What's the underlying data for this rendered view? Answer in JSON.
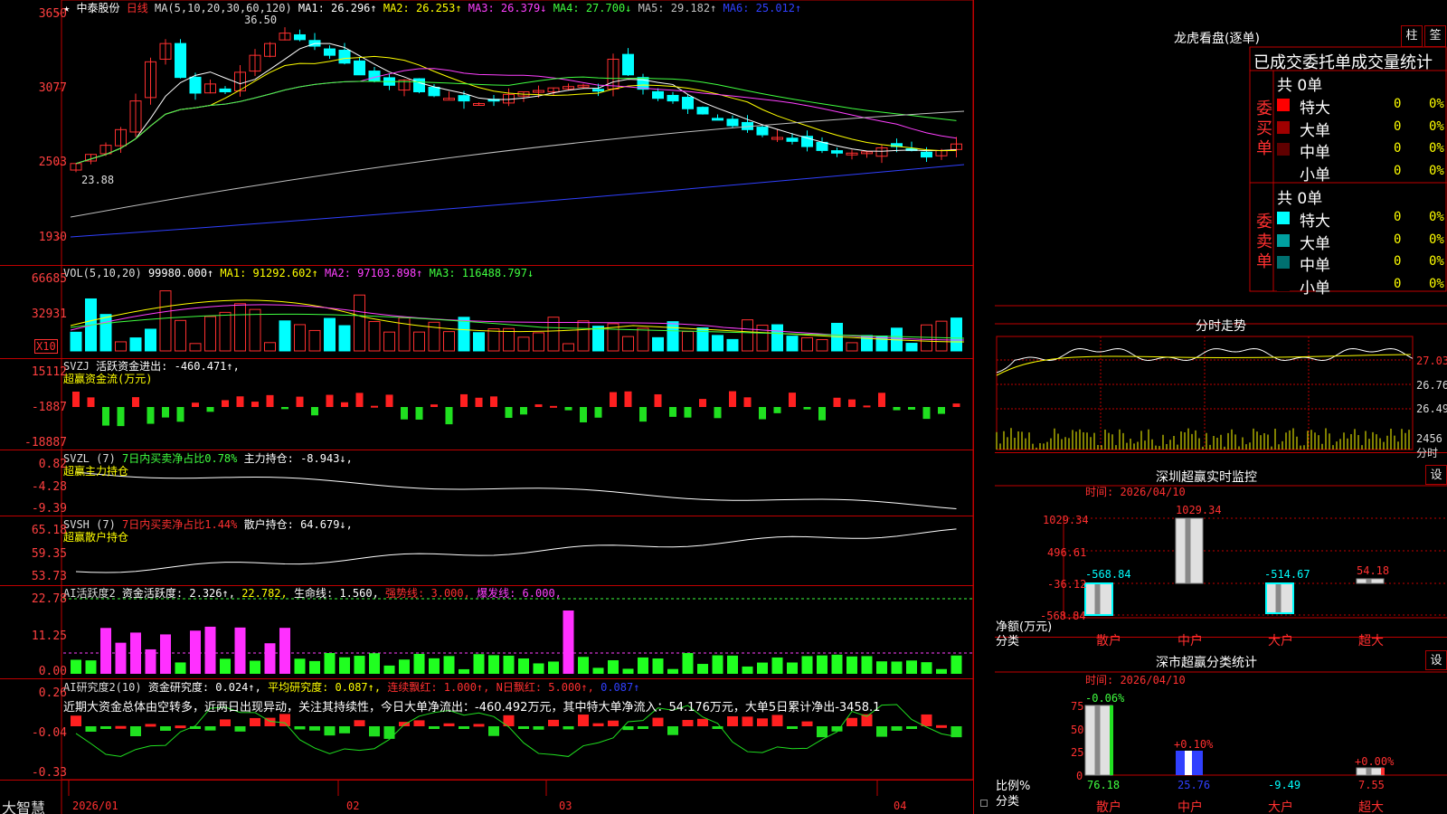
{
  "stock": {
    "star": "★",
    "name": "中泰股份",
    "period": "日线",
    "ma_label": "MA(5,10,20,30,60,120)",
    "ma": [
      {
        "t": "MA1:",
        "v": "26.296↑",
        "c": "#fff"
      },
      {
        "t": "MA2:",
        "v": "26.253↑",
        "c": "#ffff00"
      },
      {
        "t": "MA3:",
        "v": "26.379↓",
        "c": "#ff40ff"
      },
      {
        "t": "MA4:",
        "v": "27.700↓",
        "c": "#40ff40"
      },
      {
        "t": "MA5:",
        "v": "29.182↑",
        "c": "#c0c0c0"
      },
      {
        "t": "MA6:",
        "v": "25.012↑",
        "c": "#3040ff"
      }
    ],
    "high": "36.50",
    "low": "23.88",
    "yticks": [
      "3650",
      "3077",
      "2503",
      "1930"
    ]
  },
  "vol": {
    "label": "VOL(5,10,20)",
    "value": "99980.000↑",
    "ma1": "MA1: 91292.602↑",
    "ma2": "MA2: 97103.898↑",
    "ma3": "MA3: 116488.797↓",
    "yticks": [
      "66685",
      "32931"
    ],
    "unit": "X10"
  },
  "svzj": {
    "label": "SVZJ",
    "title": "活跃资金进出: -460.471↑,",
    "sub": "超赢资金流(万元)",
    "yticks": [
      "15112",
      "-1887",
      "-18887"
    ]
  },
  "svzl": {
    "label": "SVZL (7)",
    "t1": "7日内买卖净占比0.78%",
    "t2": "主力持仓: -8.943↓,",
    "sub": "超赢主力持仓",
    "yticks": [
      "0.82",
      "-4.28",
      "-9.39"
    ]
  },
  "svsh": {
    "label": "SVSH (7)",
    "t1": "7日内买卖净占比1.44%",
    "t2": "散户持仓: 64.679↓,",
    "sub": "超赢散户持仓",
    "yticks": [
      "65.18",
      "59.35",
      "53.73"
    ]
  },
  "ai1": {
    "label": "AI活跃度2",
    "t1": "资金活跃度: 2.326↑,",
    "t2": "22.782,",
    "t3": "生命线: 1.560,",
    "t4": "强势线: 3.000,",
    "t5": "爆发线: 6.000,",
    "yticks": [
      "22.78",
      "11.25",
      "0.00"
    ]
  },
  "ai2": {
    "label": "AI研究度2(10)",
    "t1": "资金研究度: 0.024↑,",
    "t2": "平均研究度: 0.087↑,",
    "t3": "连续飘红: 1.000↑,",
    "t4": "N日飘红: 5.000↑,",
    "t5": "0.087↑",
    "text": "近期大资金总体由空转多，近两日出现异动，关注其持续性，今日大单净流出：-460.492万元，其中特大单净流入：54.176万元，大单5日累计净出-3458.1",
    "yticks": [
      "0.26",
      "-0.04",
      "-0.33"
    ]
  },
  "xaxis": {
    "labels": [
      "2026/01",
      "02",
      "03",
      "04"
    ],
    "brand": "大智慧"
  },
  "lhb": {
    "title": "龙虎看盘(逐单)",
    "btn1": "柱",
    "btn2": "筌",
    "heading": "已成交委托单成交量统计",
    "buy": {
      "side": "委买单",
      "total": "共 0单",
      "rows": [
        {
          "n": "特大",
          "c": "#ff0000",
          "q": "0",
          "p": "0%"
        },
        {
          "n": "大单",
          "c": "#a00000",
          "q": "0",
          "p": "0%"
        },
        {
          "n": "中单",
          "c": "#600000",
          "q": "0",
          "p": "0%"
        },
        {
          "n": "小单",
          "c": "#000",
          "q": "0",
          "p": "0%"
        }
      ]
    },
    "sell": {
      "side": "委卖单",
      "total": "共 0单",
      "rows": [
        {
          "n": "特大",
          "c": "#00ffff",
          "q": "0",
          "p": "0%"
        },
        {
          "n": "大单",
          "c": "#00a0a0",
          "q": "0",
          "p": "0%"
        },
        {
          "n": "中单",
          "c": "#007070",
          "q": "0",
          "p": "0%"
        },
        {
          "n": "小单",
          "c": "#000",
          "q": "0",
          "p": "0%"
        }
      ]
    }
  },
  "fs": {
    "title": "分时走势",
    "p1": "27.03",
    "p2": "26.76",
    "p3": "26.49",
    "vol": "2456",
    "unit": "分时"
  },
  "szjk": {
    "title": "深圳超赢实时监控",
    "btn": "设",
    "time": "时间: 2026/04/10",
    "yticks": [
      "1029.34",
      "496.61",
      "-36.12",
      "-568.84"
    ],
    "ylabel": "净额(万元)",
    "xlabel": "分类",
    "bars": [
      {
        "cat": "散户",
        "v": "-568.84"
      },
      {
        "cat": "中户",
        "v": "1029.34"
      },
      {
        "cat": "大户",
        "v": "-514.67"
      },
      {
        "cat": "超大",
        "v": "54.18"
      }
    ]
  },
  "szfl": {
    "title": "深市超赢分类统计",
    "btn": "设",
    "time": "时间: 2026/04/10",
    "yticks": [
      "75",
      "50",
      "25",
      "0"
    ],
    "ylabel": "比例%",
    "xlabel": "分类",
    "bars": [
      {
        "cat": "散户",
        "top": "-0.06%",
        "bot": "76.18"
      },
      {
        "cat": "中户",
        "top": "+0.10%",
        "bot": "25.76"
      },
      {
        "cat": "大户",
        "top": "",
        "bot": "-9.49"
      },
      {
        "cat": "超大",
        "top": "+0.00%",
        "bot": "7.55"
      }
    ]
  }
}
